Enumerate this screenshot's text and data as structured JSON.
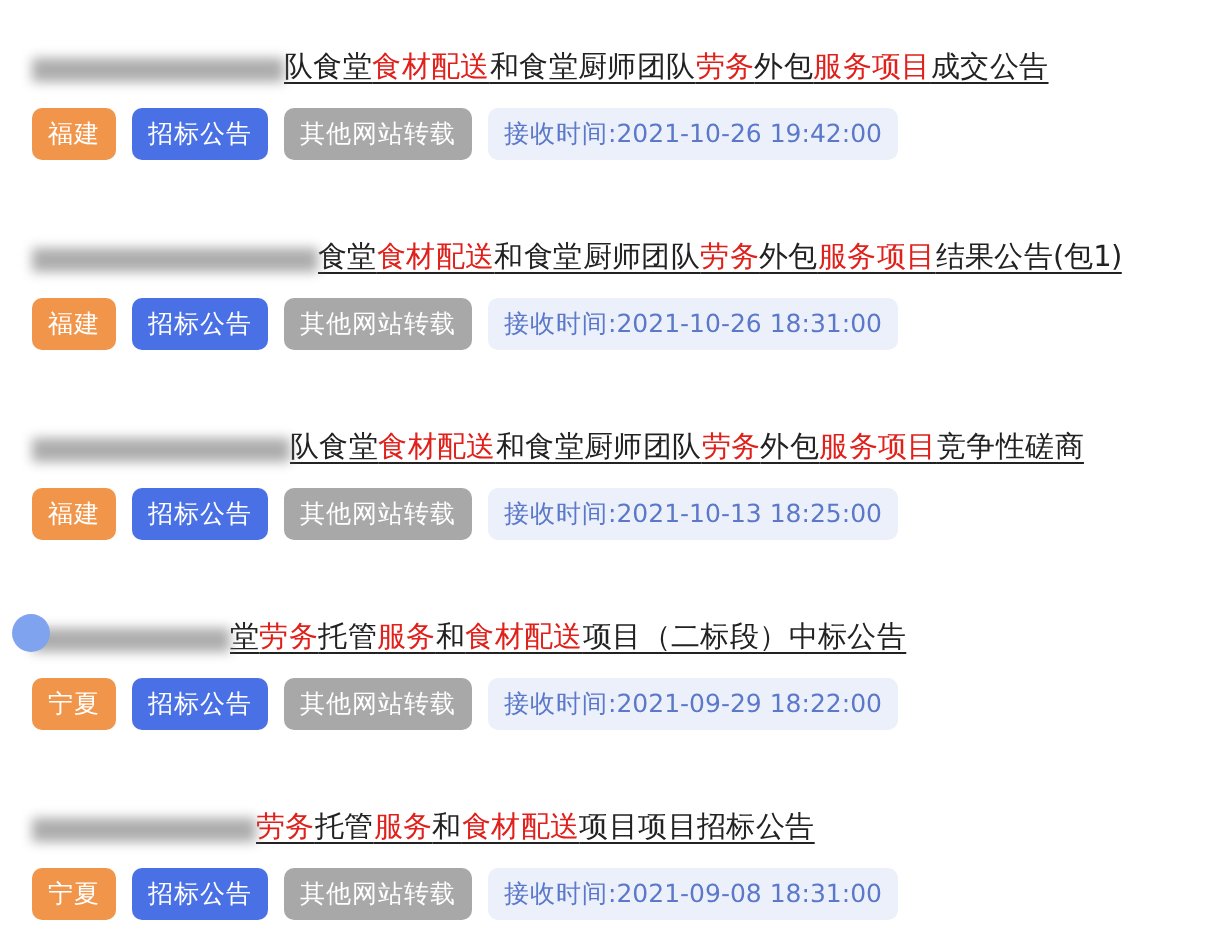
{
  "items": [
    {
      "title": [
        {
          "text": "队食堂",
          "highlight": false
        },
        {
          "text": "食材配送",
          "highlight": true
        },
        {
          "text": "和食堂厨师团队",
          "highlight": false
        },
        {
          "text": "劳务",
          "highlight": true
        },
        {
          "text": "外包",
          "highlight": false
        },
        {
          "text": "服务项目",
          "highlight": true
        },
        {
          "text": "成交公告",
          "highlight": false
        }
      ],
      "tags": [
        {
          "kind": "region",
          "text": "福建"
        },
        {
          "kind": "type",
          "text": "招标公告"
        },
        {
          "kind": "source",
          "text": "其他网站转载"
        },
        {
          "kind": "time",
          "text": "接收时间:2021-10-26 19:42:00"
        }
      ]
    },
    {
      "title": [
        {
          "text": "食堂",
          "highlight": false
        },
        {
          "text": "食材配送",
          "highlight": true
        },
        {
          "text": "和食堂厨师团队",
          "highlight": false
        },
        {
          "text": "劳务",
          "highlight": true
        },
        {
          "text": "外包",
          "highlight": false
        },
        {
          "text": "服务项目",
          "highlight": true
        },
        {
          "text": "结果公告(包1)",
          "highlight": false
        }
      ],
      "tags": [
        {
          "kind": "region",
          "text": "福建"
        },
        {
          "kind": "type",
          "text": "招标公告"
        },
        {
          "kind": "source",
          "text": "其他网站转载"
        },
        {
          "kind": "time",
          "text": "接收时间:2021-10-26 18:31:00"
        }
      ]
    },
    {
      "title": [
        {
          "text": "队食堂",
          "highlight": false
        },
        {
          "text": "食材配送",
          "highlight": true
        },
        {
          "text": "和食堂厨师团队",
          "highlight": false
        },
        {
          "text": "劳务",
          "highlight": true
        },
        {
          "text": "外包",
          "highlight": false
        },
        {
          "text": "服务项目",
          "highlight": true
        },
        {
          "text": "竞争性磋商",
          "highlight": false
        }
      ],
      "tags": [
        {
          "kind": "region",
          "text": "福建"
        },
        {
          "kind": "type",
          "text": "招标公告"
        },
        {
          "kind": "source",
          "text": "其他网站转载"
        },
        {
          "kind": "time",
          "text": "接收时间:2021-10-13 18:25:00"
        }
      ]
    },
    {
      "title": [
        {
          "text": "堂",
          "highlight": false
        },
        {
          "text": "劳务",
          "highlight": true
        },
        {
          "text": "托管",
          "highlight": false
        },
        {
          "text": "服务",
          "highlight": true
        },
        {
          "text": "和",
          "highlight": false
        },
        {
          "text": "食材配送",
          "highlight": true
        },
        {
          "text": "项目（二标段）中标公告",
          "highlight": false
        }
      ],
      "tags": [
        {
          "kind": "region",
          "text": "宁夏"
        },
        {
          "kind": "type",
          "text": "招标公告"
        },
        {
          "kind": "source",
          "text": "其他网站转载"
        },
        {
          "kind": "time",
          "text": "接收时间:2021-09-29 18:22:00"
        }
      ]
    },
    {
      "title": [
        {
          "text": "劳务",
          "highlight": true
        },
        {
          "text": "托管",
          "highlight": false
        },
        {
          "text": "服务",
          "highlight": true
        },
        {
          "text": "和",
          "highlight": false
        },
        {
          "text": "食材配送",
          "highlight": true
        },
        {
          "text": "项目项目招标公告",
          "highlight": false
        }
      ],
      "tags": [
        {
          "kind": "region",
          "text": "宁夏"
        },
        {
          "kind": "type",
          "text": "招标公告"
        },
        {
          "kind": "source",
          "text": "其他网站转载"
        },
        {
          "kind": "time",
          "text": "接收时间:2021-09-08 18:31:00"
        }
      ]
    }
  ]
}
